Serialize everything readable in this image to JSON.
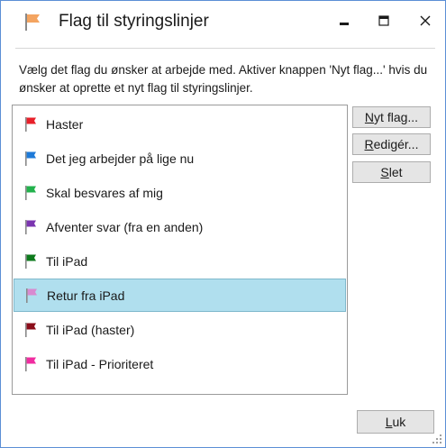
{
  "window": {
    "title": "Flag til styringslinjer",
    "title_icon": "orange-flag-icon",
    "controls": [
      "minimize-icon",
      "maximize-icon",
      "close-icon"
    ]
  },
  "description": "Vælg det flag du ønsker at arbejde med. Aktiver knappen 'Nyt flag...' hvis du ønsker at oprette et nyt flag til styringslinjer.",
  "flags": [
    {
      "label": "Haster",
      "color": "#e8202a",
      "selected": false
    },
    {
      "label": "Det jeg arbejder på lige nu",
      "color": "#1e7ad8",
      "selected": false
    },
    {
      "label": "Skal besvares af mig",
      "color": "#22b24c",
      "selected": false
    },
    {
      "label": "Afventer svar (fra en anden)",
      "color": "#7b35b0",
      "selected": false
    },
    {
      "label": "Til iPad",
      "color": "#0d7a1c",
      "selected": false
    },
    {
      "label": "Retur fra iPad",
      "color": "#d88ad0",
      "selected": true
    },
    {
      "label": "Til iPad (haster)",
      "color": "#8b0d1a",
      "selected": false
    },
    {
      "label": "Til iPad - Prioriteret",
      "color": "#f02ca0",
      "selected": false
    }
  ],
  "buttons": {
    "new_flag": {
      "pre": "",
      "mnemonic": "N",
      "post": "yt flag..."
    },
    "edit": {
      "pre": "",
      "mnemonic": "R",
      "post": "edigér..."
    },
    "delete": {
      "pre": "",
      "mnemonic": "S",
      "post": "let"
    },
    "ok": {
      "pre": "",
      "mnemonic": "L",
      "post": "uk"
    }
  },
  "colors": {
    "selection": "#b0dfee",
    "title_flag": "#f4a460"
  }
}
